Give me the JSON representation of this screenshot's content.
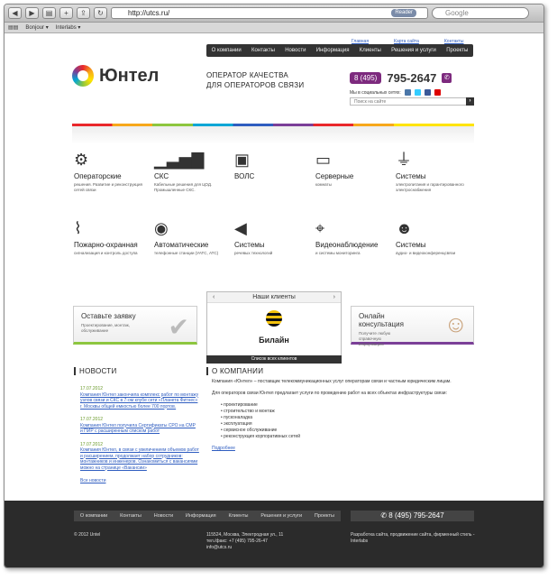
{
  "browser": {
    "url": "http://utcs.ru/",
    "reader_label": "Reader",
    "search_placeholder": "Google",
    "bookmarks": [
      "Bonjour ▾",
      "Interlabs ▾"
    ]
  },
  "top_links": [
    "Главная",
    "Карта сайта",
    "Контакты"
  ],
  "top_nav": [
    "О компании",
    "Контакты",
    "Новости",
    "Информация",
    "Клиенты",
    "Решения и услуги",
    "Проекты"
  ],
  "logo_text": "Юнтел",
  "slogan": [
    "ОПЕРАТОР КАЧЕСТВА",
    "ДЛЯ ОПЕРАТОРОВ СВЯЗИ"
  ],
  "phone": {
    "code": "8 (495)",
    "number": "795-2647"
  },
  "social_label": "Мы в социальных сетях:",
  "search_placeholder": "Поиск на сайте",
  "services": [
    {
      "title": "Операторские",
      "desc": "решения. Развитие и реконструкция сетей связи",
      "icon": "gears-icon"
    },
    {
      "title": "СКС",
      "desc": "Кабельные решения для ЦОД. Промышленные СКС.",
      "icon": "signal-bars-icon"
    },
    {
      "title": "ВОЛС",
      "desc": "",
      "icon": "fiber-icon"
    },
    {
      "title": "Серверные",
      "desc": "комнаты",
      "icon": "server-icon"
    },
    {
      "title": "Системы",
      "desc": "электропитания и гарантированного электроснабжения",
      "icon": "plug-icon"
    },
    {
      "title": "Пожарно-охранная",
      "desc": "сигнализация и контроль доступа",
      "icon": "antenna-icon"
    },
    {
      "title": "Автоматические",
      "desc": "телефонные станции (УАТС, АТС)",
      "icon": "broadcast-icon"
    },
    {
      "title": "Системы",
      "desc": "речевых технологий",
      "icon": "speaker-icon"
    },
    {
      "title": "Видеонаблюдение",
      "desc": "и системы мониторинга",
      "icon": "camera-icon"
    },
    {
      "title": "Системы",
      "desc": "аудио- и видеоконференцсвязи",
      "icon": "conference-icon"
    }
  ],
  "request_box": {
    "title": "Оставьте заявку",
    "desc": "Проектирование, монтаж, обслуживание"
  },
  "clients_box": {
    "title": "Наши клиенты",
    "client": "Билайн",
    "all": "Список всех клиентов"
  },
  "consult_box": {
    "title": "Онлайн консультация",
    "desc": "Получите любую справочную информацию"
  },
  "news_title": "НОВОСТИ",
  "news": [
    {
      "date": "17.07.2012",
      "text": "Компания Юнтел закончила комплекс работ по монтажу узлов связи и СКС в 7-ом клубе сети «Планета Фитнес» г. Москвы общей емкостью более 700 портов."
    },
    {
      "date": "17.07.2012",
      "text": "Компания Юнтел получила Сертификаты СРО на СМР и ПИР с расширенным списком работ"
    },
    {
      "date": "17.07.2012",
      "text": "Компания Юнтел, в связи с увеличением объемов работ и расширением, продолжает набор сотрудников: монтажников и инженеров. Ознакомиться с вакансиями можно на странице «Вакансии»"
    }
  ],
  "news_all": "Все новости",
  "about_title": "О КОМПАНИИ",
  "about_p1": "Компания «Юнтел» – поставщик телекоммуникационных услуг операторам связи и частным юридическим лицам.",
  "about_p2": "Для операторов связи Юнтел предлагает услуги по проведению работ на всех объектах инфраструктуры связи:",
  "about_list": [
    "проектирование",
    "строительство и монтаж",
    "пусконаладка",
    "эксплуатация",
    "сервисное обслуживание",
    "реконструкция корпоративных сетей"
  ],
  "about_more": "Подробнее",
  "footer_nav": [
    "О компании",
    "Контакты",
    "Новости",
    "Информация",
    "Клиенты",
    "Решения и услуги",
    "Проекты"
  ],
  "footer_phone": "8 (495) 795-2647",
  "footer_copy": "© 2012 Untel",
  "footer_addr": [
    "115524, Москва, Электродная ул., 11",
    "тел./факс: +7 (495) 795-26-47",
    "info@utcs.ru"
  ],
  "footer_dev": "Разработка сайта, продвижение сайта, фирменный стиль - Interlabs"
}
